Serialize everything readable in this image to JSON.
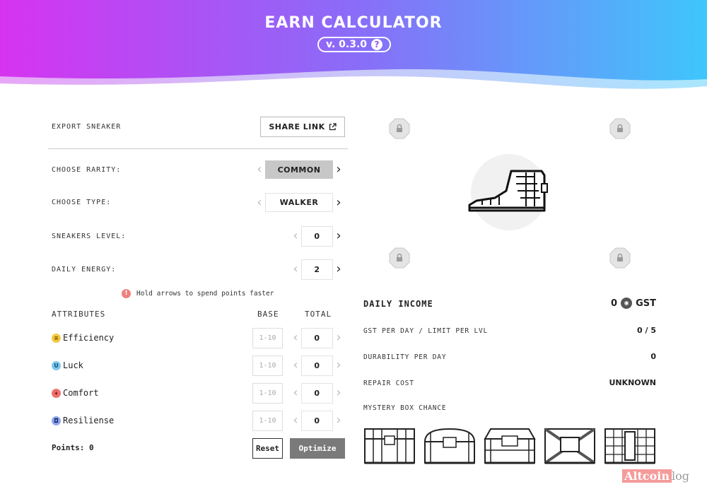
{
  "header": {
    "title": "EARN CALCULATOR",
    "version": "v. 0.3.0",
    "help_icon": "?"
  },
  "export": {
    "label": "EXPORT SNEAKER",
    "share_button": "SHARE LINK",
    "share_icon": "external-link-icon"
  },
  "settings": {
    "rarity_label": "CHOOSE RARITY:",
    "rarity_value": "COMMON",
    "type_label": "CHOOSE TYPE:",
    "type_value": "WALKER",
    "level_label": "SNEAKERS LEVEL:",
    "level_value": "0",
    "energy_label": "DAILY ENERGY:",
    "energy_value": "2"
  },
  "hint": {
    "icon": "!",
    "text": "Hold arrows to spend points faster"
  },
  "attributes": {
    "header": "ATTRIBUTES",
    "base_header": "BASE",
    "total_header": "TOTAL",
    "placeholder": "1-10",
    "items": [
      {
        "name": "Efficiency",
        "icon": "efficiency-icon",
        "glyph": "≡",
        "color": "#f5c842",
        "total": "0"
      },
      {
        "name": "Luck",
        "icon": "luck-icon",
        "glyph": "U",
        "color": "#7cc8f0",
        "total": "0"
      },
      {
        "name": "Comfort",
        "icon": "comfort-icon",
        "glyph": "+",
        "color": "#f07070",
        "total": "0"
      },
      {
        "name": "Resiliense",
        "icon": "resilience-icon",
        "glyph": "◘",
        "color": "#8fa8f0",
        "total": "0"
      }
    ]
  },
  "points": "Points: 0",
  "buttons": {
    "reset": "Reset",
    "optimize": "Optimize"
  },
  "income": {
    "title": "DAILY INCOME",
    "value": "0",
    "currency": "GST",
    "gst_per_day_label": "GST PER DAY / LIMIT PER LVL",
    "gst_per_day_value": "0 / 5",
    "durability_label": "DURABILITY PER DAY",
    "durability_value": "0",
    "repair_label": "REPAIR COST",
    "repair_value": "UNKNOWN",
    "mystery_label": "MYSTERY BOX CHANCE"
  },
  "watermark": {
    "part1": "Altcoin",
    "part2": "log"
  },
  "colors": {
    "gradient_start": "#d633f0",
    "gradient_mid": "#8a6cf8",
    "gradient_end": "#3fc6fb",
    "optimize_bg": "#7a7a7a",
    "rarity_bg": "#c7c7c7"
  }
}
